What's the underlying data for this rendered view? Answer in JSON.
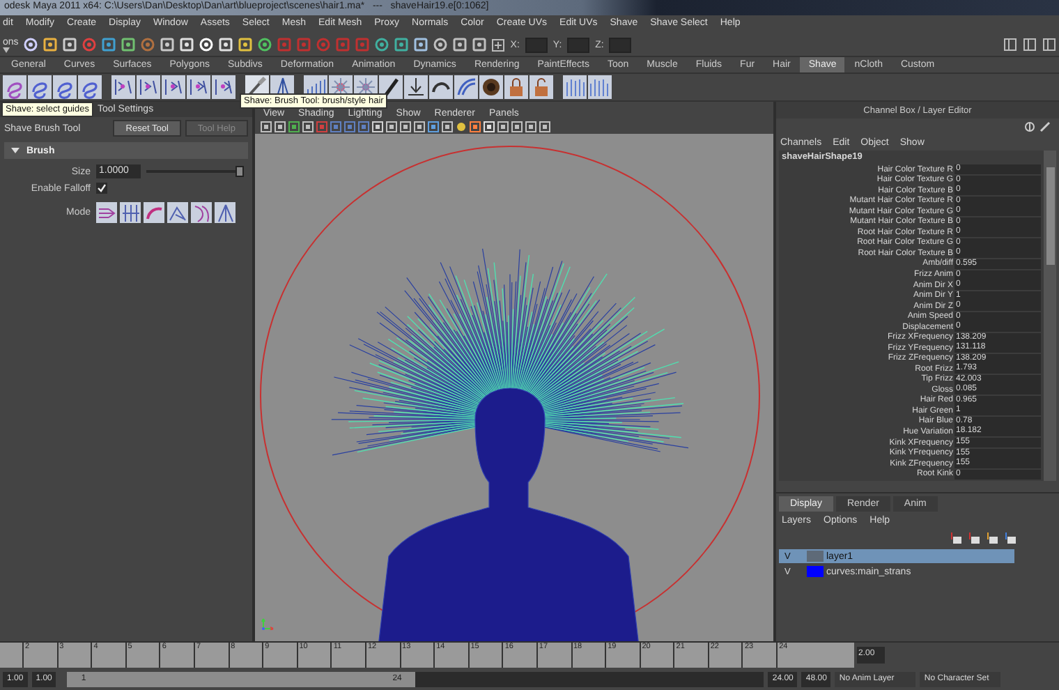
{
  "window": {
    "title": "odesk Maya 2011 x64: C:\\Users\\Dan\\Desktop\\Dan\\art\\blueproject\\scenes\\hair1.ma*   ---   shaveHair19.e[0:1062]"
  },
  "menu_bar": [
    "dit",
    "Modify",
    "Create",
    "Display",
    "Window",
    "Assets",
    "Select",
    "Mesh",
    "Edit Mesh",
    "Proxy",
    "Normals",
    "Color",
    "Create UVs",
    "Edit UVs",
    "Shave",
    "Shave Select",
    "Help"
  ],
  "status_line": {
    "mode_menu": "ons",
    "coords": [
      "X:",
      "Y:",
      "Z:"
    ]
  },
  "shelf": {
    "tabs": [
      {
        "label": "General",
        "selected": false
      },
      {
        "label": "Curves",
        "selected": false
      },
      {
        "label": "Surfaces",
        "selected": false
      },
      {
        "label": "Polygons",
        "selected": false
      },
      {
        "label": "Subdivs",
        "selected": false
      },
      {
        "label": "Deformation",
        "selected": false
      },
      {
        "label": "Animation",
        "selected": false
      },
      {
        "label": "Dynamics",
        "selected": false
      },
      {
        "label": "Rendering",
        "selected": false
      },
      {
        "label": "PaintEffects",
        "selected": false
      },
      {
        "label": "Toon",
        "selected": false
      },
      {
        "label": "Muscle",
        "selected": false
      },
      {
        "label": "Fluids",
        "selected": false
      },
      {
        "label": "Fur",
        "selected": false
      },
      {
        "label": "Hair",
        "selected": false
      },
      {
        "label": "Shave",
        "selected": true
      },
      {
        "label": "nCloth",
        "selected": false
      },
      {
        "label": "Custom",
        "selected": false
      }
    ]
  },
  "tooltips": [
    "Shave: select guides",
    "Shave: Brush Tool: brush/style hair"
  ],
  "tool_settings": {
    "header": "Tool Settings",
    "tool_name": "Shave Brush Tool",
    "buttons": [
      {
        "label": "Reset Tool",
        "disabled": false
      },
      {
        "label": "Tool Help",
        "disabled": true
      }
    ],
    "section": {
      "title": "Brush",
      "expanded": true
    },
    "size": {
      "label": "Size",
      "value": "1.0000",
      "level": 1
    },
    "falloff": {
      "label": "Enable Falloff",
      "checked": true
    },
    "mode_label": "Mode"
  },
  "viewport": {
    "menu": [
      "View",
      "Shading",
      "Lighting",
      "Show",
      "Renderer",
      "Panels"
    ]
  },
  "channel_box": {
    "title": "Channel Box / Layer Editor",
    "menu": [
      "Channels",
      "Edit",
      "Object",
      "Show"
    ],
    "node": "shaveHairShape19",
    "attributes": [
      {
        "name": "Hair Color Texture R",
        "value": "0"
      },
      {
        "name": "Hair Color Texture G",
        "value": "0"
      },
      {
        "name": "Hair Color Texture B",
        "value": "0"
      },
      {
        "name": "Mutant Hair Color Texture R",
        "value": "0"
      },
      {
        "name": "Mutant Hair Color Texture G",
        "value": "0"
      },
      {
        "name": "Mutant Hair Color Texture B",
        "value": "0"
      },
      {
        "name": "Root Hair Color Texture R",
        "value": "0"
      },
      {
        "name": "Root Hair Color Texture G",
        "value": "0"
      },
      {
        "name": "Root Hair Color Texture B",
        "value": "0"
      },
      {
        "name": "Amb/diff",
        "value": "0.595"
      },
      {
        "name": "Frizz Anim",
        "value": "0"
      },
      {
        "name": "Anim Dir X",
        "value": "0"
      },
      {
        "name": "Anim Dir Y",
        "value": "1"
      },
      {
        "name": "Anim Dir Z",
        "value": "0"
      },
      {
        "name": "Anim Speed",
        "value": "0"
      },
      {
        "name": "Displacement",
        "value": "0"
      },
      {
        "name": "Frizz XFrequency",
        "value": "138.209"
      },
      {
        "name": "Frizz YFrequency",
        "value": "131.118"
      },
      {
        "name": "Frizz ZFrequency",
        "value": "138.209"
      },
      {
        "name": "Root Frizz",
        "value": "1.793"
      },
      {
        "name": "Tip Frizz",
        "value": "42.003"
      },
      {
        "name": "Gloss",
        "value": "0.085"
      },
      {
        "name": "Hair Red",
        "value": "0.965"
      },
      {
        "name": "Hair Green",
        "value": "1"
      },
      {
        "name": "Hair Blue",
        "value": "0.78"
      },
      {
        "name": "Hue Variation",
        "value": "18.182"
      },
      {
        "name": "Kink XFrequency",
        "value": "155"
      },
      {
        "name": "Kink YFrequency",
        "value": "155"
      },
      {
        "name": "Kink ZFrequency",
        "value": "155"
      },
      {
        "name": "Root Kink",
        "value": "0"
      }
    ]
  },
  "layer_editor": {
    "tabs": [
      {
        "label": "Display",
        "selected": true
      },
      {
        "label": "Render",
        "selected": false
      },
      {
        "label": "Anim",
        "selected": false
      }
    ],
    "menu": [
      "Layers",
      "Options",
      "Help"
    ],
    "layers": [
      {
        "visibility": "V",
        "name": "layer1",
        "selected": true,
        "color": "#5e6a78"
      },
      {
        "visibility": "V",
        "name": "curves:main_strans",
        "selected": false,
        "color": "#0000ff"
      }
    ]
  },
  "time_slider": {
    "ticks": [
      "2",
      "3",
      "4",
      "5",
      "6",
      "7",
      "8",
      "9",
      "10",
      "11",
      "12",
      "13",
      "14",
      "15",
      "16",
      "17",
      "18",
      "19",
      "20",
      "21",
      "22",
      "23",
      "24"
    ],
    "current": "2.00"
  },
  "range_slider": {
    "start": "1.00",
    "playback_start": "1.00",
    "range_start": "1",
    "range_end": "24",
    "level": 0.5,
    "playback_end": "24.00",
    "end": "48.00",
    "anim_layer": "No Anim Layer",
    "character_set": "No Character Set"
  }
}
